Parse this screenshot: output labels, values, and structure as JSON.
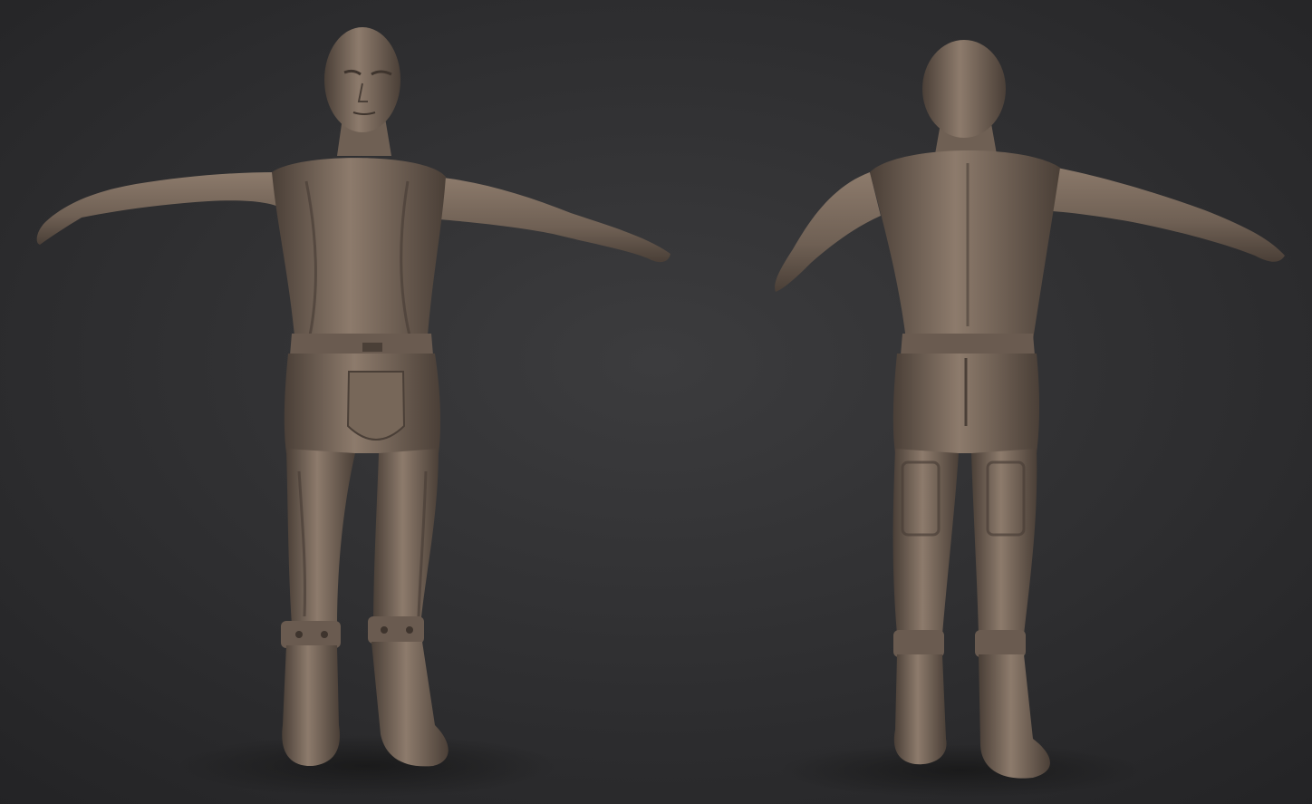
{
  "scene": {
    "background_center": "#3c3c3e",
    "background_edge": "#232325",
    "clay_light": "#8d7b6c",
    "clay_mid": "#6f6054",
    "clay_dark": "#4a3f37",
    "shadow": "#151515"
  },
  "figures": [
    {
      "view": "front-view",
      "icon": "sculpted-male-figure-front"
    },
    {
      "view": "back-view",
      "icon": "sculpted-male-figure-back"
    }
  ]
}
